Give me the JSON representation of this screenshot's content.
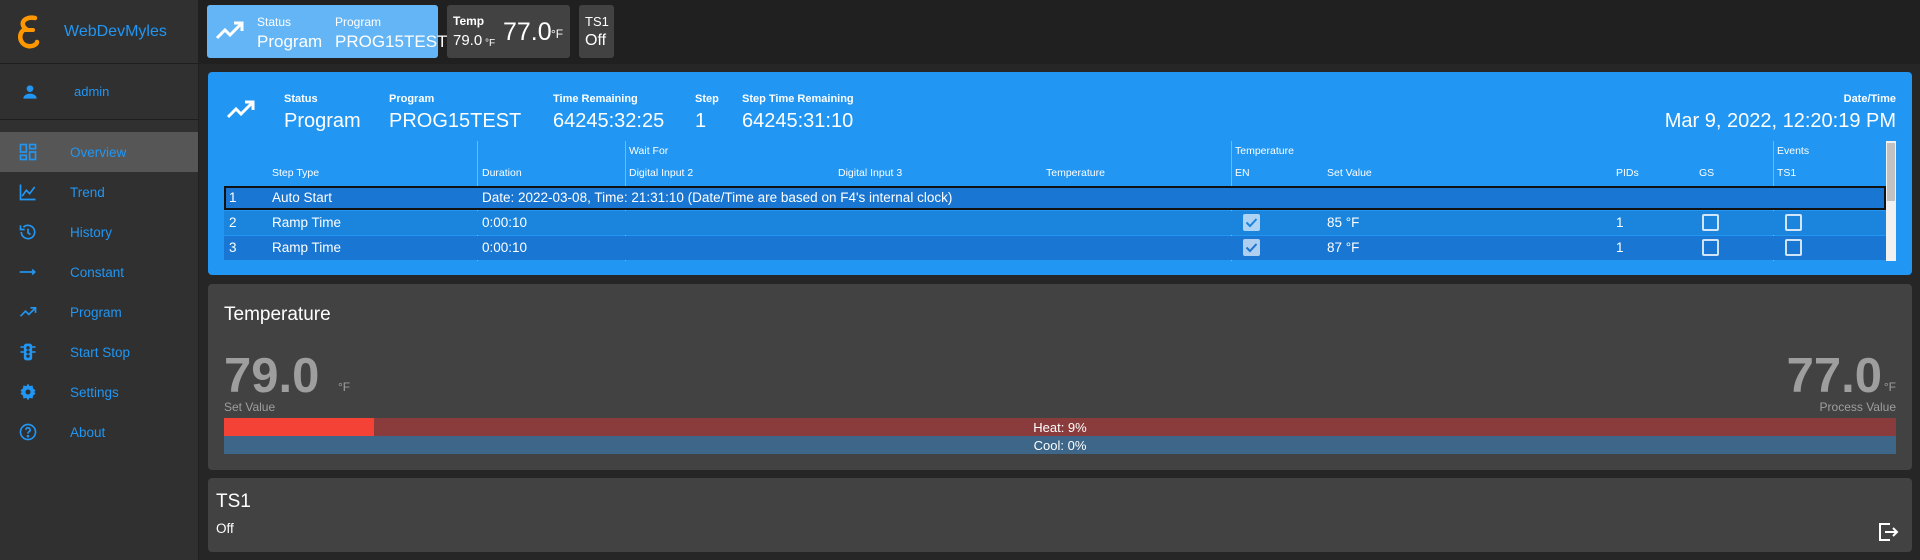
{
  "app": {
    "name": "WebDevMyles"
  },
  "user": {
    "name": "admin"
  },
  "nav": [
    {
      "label": "Overview",
      "icon": "dashboard-icon",
      "active": true
    },
    {
      "label": "Trend",
      "icon": "line-chart-icon"
    },
    {
      "label": "History",
      "icon": "history-icon"
    },
    {
      "label": "Constant",
      "icon": "arrow-right-icon"
    },
    {
      "label": "Program",
      "icon": "trending-up-icon"
    },
    {
      "label": "Start Stop",
      "icon": "traffic-light-icon"
    },
    {
      "label": "Settings",
      "icon": "gear-icon"
    },
    {
      "label": "About",
      "icon": "help-circle-icon"
    }
  ],
  "topbar": {
    "status": {
      "status_label": "Status",
      "status_value": "Program",
      "program_label": "Program",
      "program_value": "PROG15TEST"
    },
    "temp": {
      "label": "Temp",
      "set_value": "79.0",
      "set_unit": "°F",
      "process_value": "77.0",
      "process_unit": "°F"
    },
    "ts1": {
      "label": "TS1",
      "value": "Off"
    }
  },
  "program": {
    "status_label": "Status",
    "status_value": "Program",
    "program_label": "Program",
    "program_value": "PROG15TEST",
    "time_remaining_label": "Time Remaining",
    "time_remaining_value": "64245:32:25",
    "step_label": "Step",
    "step_value": "1",
    "step_time_label": "Step Time Remaining",
    "step_time_value": "64245:31:10",
    "datetime_label": "Date/Time",
    "datetime_value": "Mar 9, 2022, 12:20:19 PM",
    "group_headers": {
      "wait_for": "Wait For",
      "temperature": "Temperature",
      "events": "Events"
    },
    "columns": {
      "step_type": "Step Type",
      "duration": "Duration",
      "digital_input_2": "Digital Input 2",
      "digital_input_3": "Digital Input 3",
      "wait_temperature": "Temperature",
      "en": "EN",
      "set_value": "Set Value",
      "pids": "PIDs",
      "gs": "GS",
      "ts1": "TS1"
    },
    "rows": [
      {
        "num": "1",
        "step_type": "Auto Start",
        "detail": "Date: 2022-03-08, Time: 21:31:10 (Date/Time are based on F4's internal clock)"
      },
      {
        "num": "2",
        "step_type": "Ramp Time",
        "duration": "0:00:10",
        "en": true,
        "set_value": "85 °F",
        "pids": "1",
        "gs": false,
        "ts1": false
      },
      {
        "num": "3",
        "step_type": "Ramp Time",
        "duration": "0:00:10",
        "en": true,
        "set_value": "87 °F",
        "pids": "1",
        "gs": false,
        "ts1": false
      }
    ]
  },
  "temperature": {
    "title": "Temperature",
    "set_value": "79.0",
    "set_unit": "°F",
    "set_caption": "Set Value",
    "process_value": "77.0",
    "process_unit": "°F",
    "process_caption": "Process Value",
    "heat_label": "Heat: 9%",
    "heat_percent": 9,
    "cool_label": "Cool: 0%",
    "cool_percent": 0
  },
  "ts1_panel": {
    "title": "TS1",
    "value": "Off",
    "icon": "exit-icon"
  },
  "colors": {
    "accent": "#2196f3",
    "heat": "#f44336",
    "status_chip": "#64b5f6"
  }
}
